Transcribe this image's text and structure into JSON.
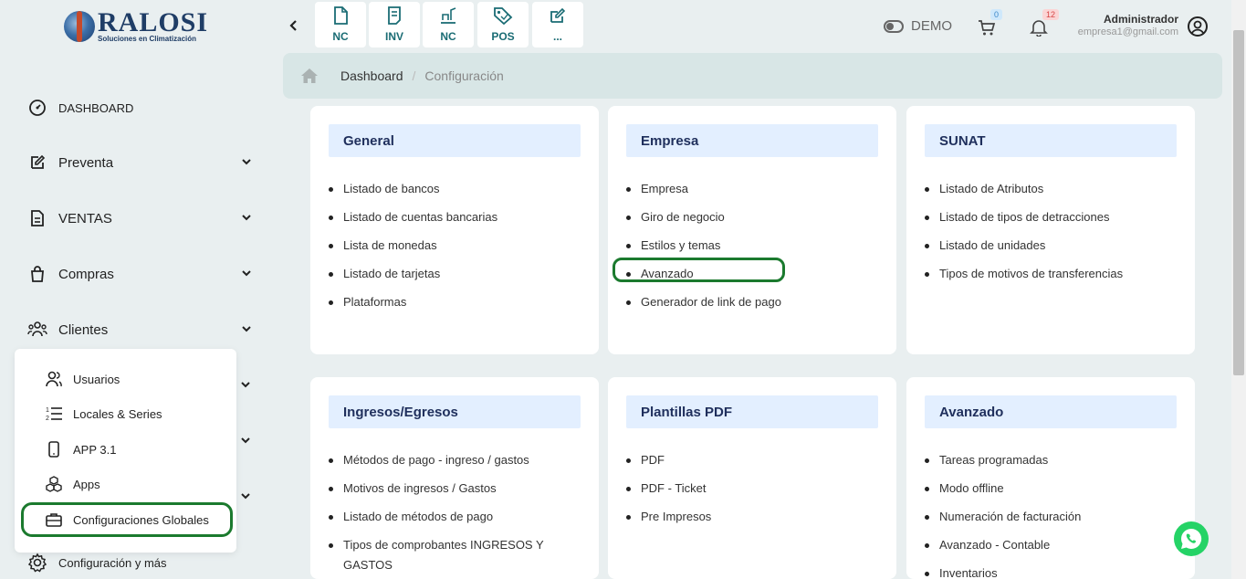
{
  "brand": {
    "name": "RALOSI",
    "tagline": "Soluciones en Climatización"
  },
  "sidebar": {
    "items": [
      {
        "label": "DASHBOARD"
      },
      {
        "label": "Preventa"
      },
      {
        "label": "VENTAS"
      },
      {
        "label": "Compras"
      },
      {
        "label": "Clientes"
      },
      {
        "label": "Configuración y más"
      }
    ],
    "submenu": [
      {
        "label": "Usuarios"
      },
      {
        "label": "Locales & Series"
      },
      {
        "label": "APP 3.1"
      },
      {
        "label": "Apps"
      },
      {
        "label": "Configuraciones Globales"
      }
    ]
  },
  "topbar": {
    "quick_buttons": [
      {
        "label": "NC",
        "icon": "file-icon"
      },
      {
        "label": "INV",
        "icon": "receipt-icon"
      },
      {
        "label": "NC",
        "icon": "note-icon"
      },
      {
        "label": "POS",
        "icon": "tag-icon"
      },
      {
        "label": "...",
        "icon": "edit-icon"
      }
    ],
    "demo_label": "DEMO",
    "cart_count": "0",
    "notifications_count": "12",
    "user_name": "Administrador",
    "user_email": "empresa1@gmail.com"
  },
  "breadcrumb": {
    "items": [
      "Dashboard",
      "Configuración"
    ]
  },
  "cards": [
    {
      "title": "General",
      "items": [
        "Listado de bancos",
        "Listado de cuentas bancarias",
        "Lista de monedas",
        "Listado de tarjetas",
        "Plataformas"
      ]
    },
    {
      "title": "Empresa",
      "items": [
        "Empresa",
        "Giro de negocio",
        "Estilos y temas",
        "Avanzado",
        "Generador de link de pago"
      ]
    },
    {
      "title": "SUNAT",
      "items": [
        "Listado de Atributos",
        "Listado de tipos de detracciones",
        "Listado de unidades",
        "Tipos de motivos de transferencias"
      ]
    },
    {
      "title": "Ingresos/Egresos",
      "items": [
        "Métodos de pago - ingreso / gastos",
        "Motivos de ingresos / Gastos",
        "Listado de métodos de pago",
        "Tipos de comprobantes INGRESOS Y GASTOS"
      ]
    },
    {
      "title": "Plantillas PDF",
      "items": [
        "PDF",
        "PDF - Ticket",
        "Pre Impresos"
      ]
    },
    {
      "title": "Avanzado",
      "items": [
        "Tareas programadas",
        "Modo offline",
        "Numeración de facturación",
        "Avanzado - Contable",
        "Inventarios"
      ]
    }
  ],
  "colors": {
    "accent": "#1a6c74",
    "highlight": "#1b7a2e",
    "card_header_bg": "#e3efff",
    "whatsapp": "#25d366"
  }
}
